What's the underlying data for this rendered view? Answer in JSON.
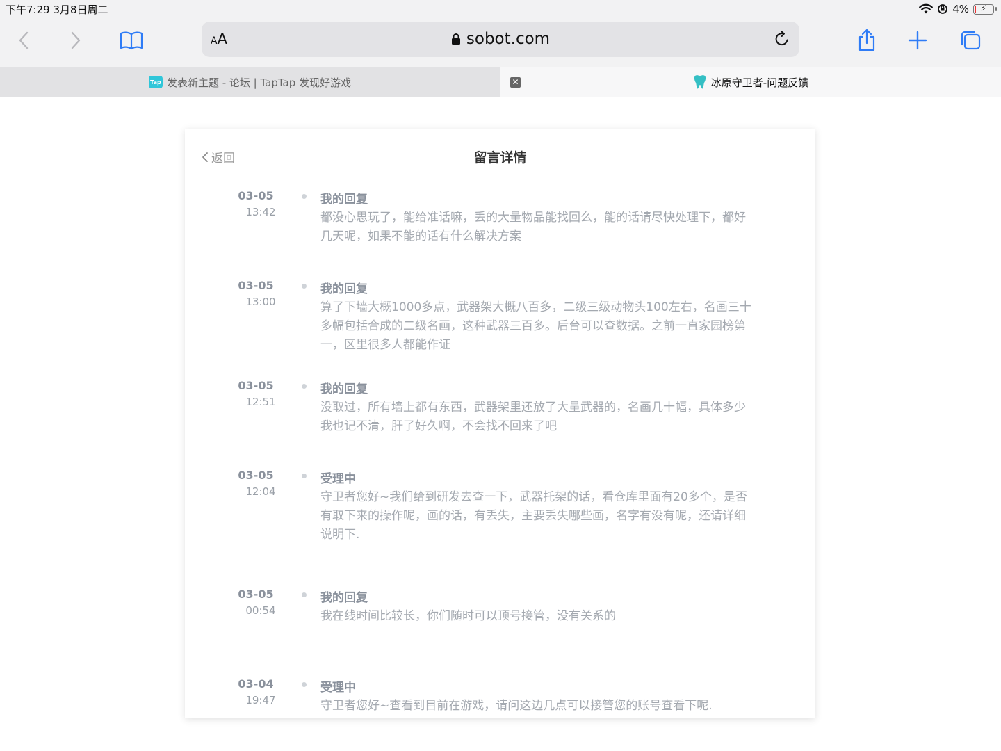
{
  "status_bar": {
    "time": "下午7:29  3月8日周二",
    "battery_label": "4%",
    "battery_level": 0.04
  },
  "toolbar": {
    "aa_small": "A",
    "aa_large": "A",
    "url": "sobot.com",
    "icons": [
      "back-icon",
      "forward-icon",
      "bookmarks-icon",
      "share-icon",
      "new-tab-icon",
      "tabs-icon"
    ]
  },
  "tabs": [
    {
      "label": "发表新主题 - 论坛 | TapTap 发现好游戏",
      "logo_text": "Tap",
      "active": false
    },
    {
      "label": "冰原守卫者-问题反馈",
      "active": true
    }
  ],
  "page": {
    "back_label": "返回",
    "title": "留言详情"
  },
  "entries": [
    {
      "date": "03-05",
      "time": "13:42",
      "status": "我的回复",
      "content": "都没心思玩了，能给准话嘛，丢的大量物品能找回么，能的话请尽快处理下，都好几天呢，如果不能的话有什么解决方案"
    },
    {
      "date": "03-05",
      "time": "13:00",
      "status": "我的回复",
      "content": "算了下墙大概1000多点，武器架大概八百多，二级三级动物头100左右，名画三十多幅包括合成的二级名画，这种武器三百多。后台可以查数据。之前一直家园榜第一，区里很多人都能作证"
    },
    {
      "date": "03-05",
      "time": "12:51",
      "status": "我的回复",
      "content": "没取过，所有墙上都有东西，武器架里还放了大量武器的，名画几十幅，具体多少我也记不清，肝了好久啊，不会找不回来了吧"
    },
    {
      "date": "03-05",
      "time": "12:04",
      "status": "受理中",
      "content": "守卫者您好~我们给到研发去查一下，武器托架的话，看仓库里面有20多个，是否有取下来的操作呢，画的话，有丢失，主要丢失哪些画，名字有没有呢，还请详细说明下."
    },
    {
      "date": "03-05",
      "time": "00:54",
      "status": "我的回复",
      "content": "我在线时间比较长，你们随时可以顶号接管，没有关系的"
    },
    {
      "date": "03-04",
      "time": "19:47",
      "status": "受理中",
      "content": "守卫者您好~查看到目前在游戏，请问这边几点可以接管您的账号查看下呢."
    }
  ]
}
